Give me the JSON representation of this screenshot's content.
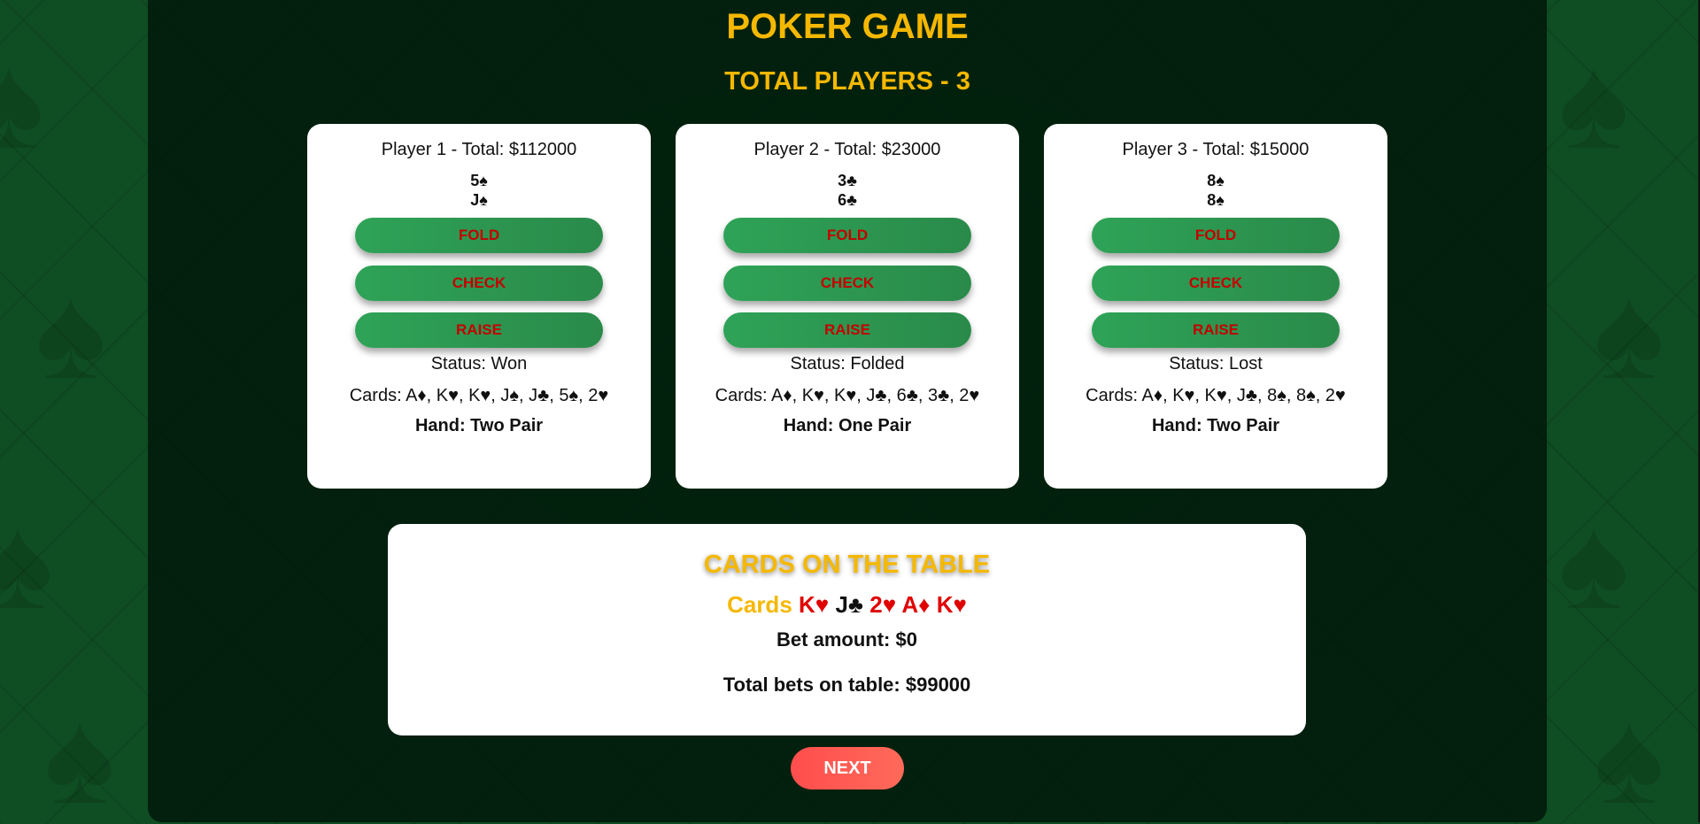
{
  "colors": {
    "gold": "#f5b800",
    "button_green": "#2ea357",
    "button_text_red": "#c40000",
    "red_suit": "#e00000",
    "next_button": "#ff5a52",
    "background_green": "#0f4d22"
  },
  "title": "POKER GAME",
  "players_heading": "TOTAL PLAYERS - 3",
  "players": [
    {
      "title": "Player 1 - Total: $112000",
      "hole_cards": [
        "5♠",
        "J♠"
      ],
      "buttons": {
        "fold": "FOLD",
        "check": "CHECK",
        "raise": "RAISE"
      },
      "status": "Status: Won",
      "cards": "Cards: A♦, K♥, K♥, J♠, J♣, 5♠, 2♥",
      "hand": "Hand: Two Pair"
    },
    {
      "title": "Player 2 - Total: $23000",
      "hole_cards": [
        "3♣",
        "6♣"
      ],
      "buttons": {
        "fold": "FOLD",
        "check": "CHECK",
        "raise": "RAISE"
      },
      "status": "Status: Folded",
      "cards": "Cards: A♦, K♥, K♥, J♣, 6♣, 3♣, 2♥",
      "hand": "Hand: One Pair"
    },
    {
      "title": "Player 3 - Total: $15000",
      "hole_cards": [
        "8♠",
        "8♠"
      ],
      "buttons": {
        "fold": "FOLD",
        "check": "CHECK",
        "raise": "RAISE"
      },
      "status": "Status: Lost",
      "cards": "Cards: A♦, K♥, K♥, J♣, 8♠, 8♠, 2♥",
      "hand": "Hand: Two Pair"
    }
  ],
  "table": {
    "title": "CARDS ON THE TABLE",
    "cards_label": "Cards",
    "cards": [
      {
        "text": "K♥",
        "color": "red"
      },
      {
        "text": "J♣",
        "color": "black"
      },
      {
        "text": "2♥",
        "color": "red"
      },
      {
        "text": "A♦",
        "color": "red"
      },
      {
        "text": "K♥",
        "color": "red"
      }
    ],
    "bet_amount": "Bet amount: $0",
    "total_bets": "Total bets on table: $99000"
  },
  "next_label": "NEXT"
}
